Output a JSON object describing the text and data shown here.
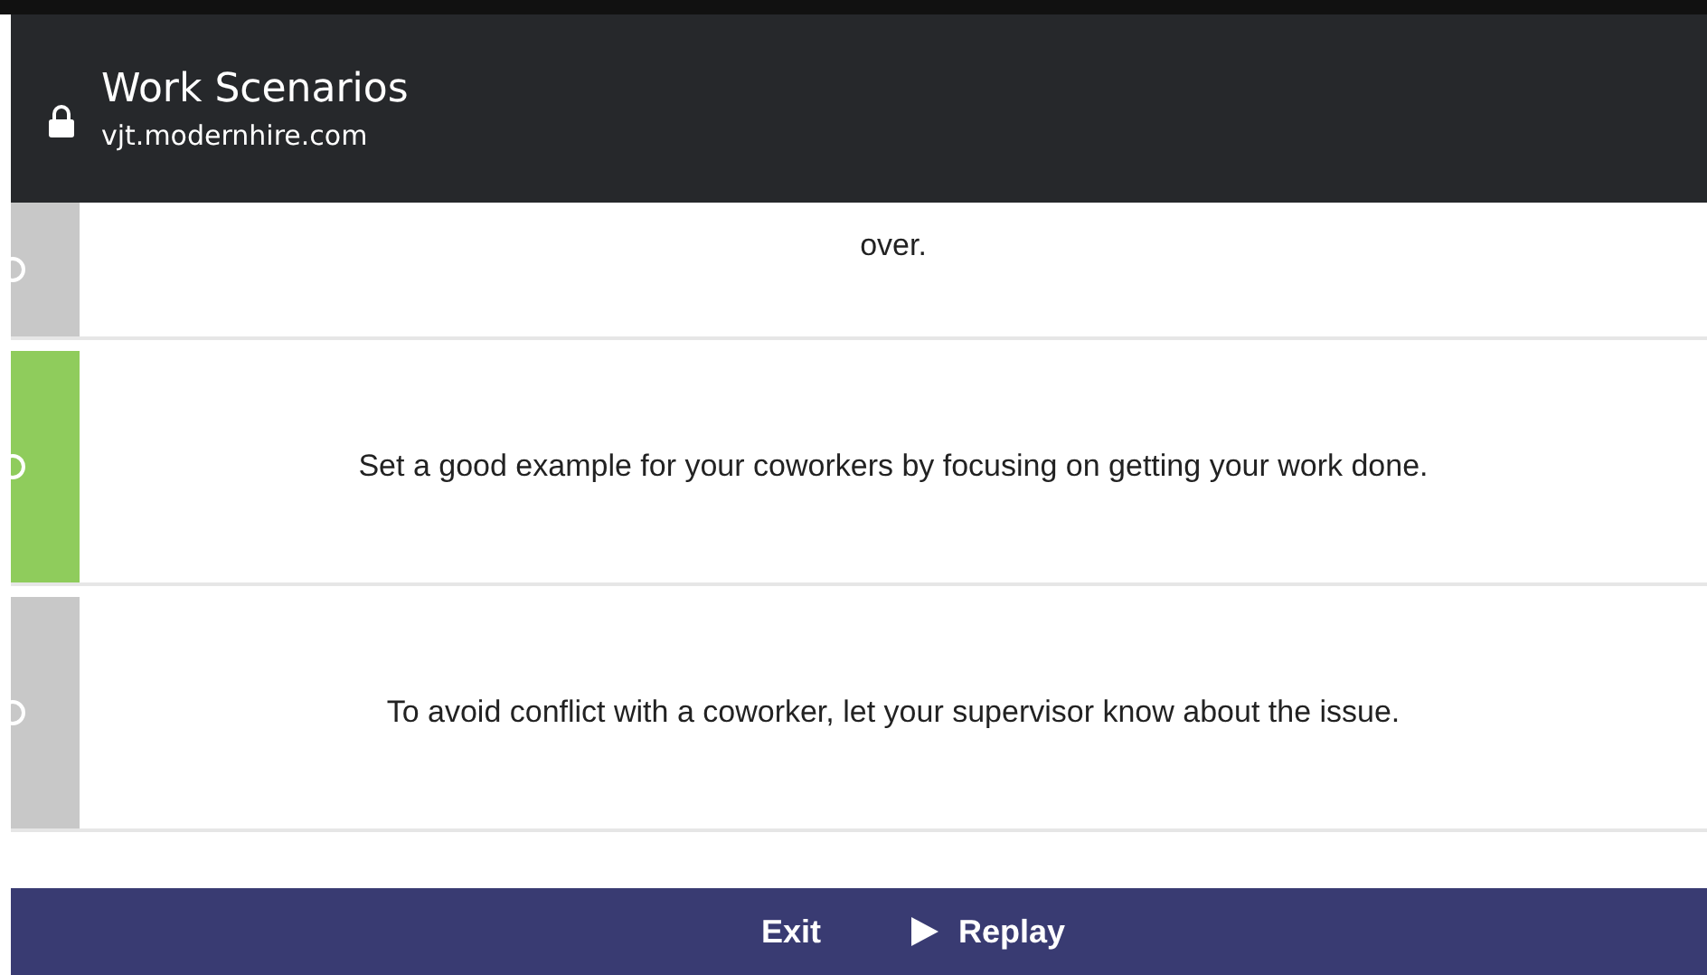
{
  "header": {
    "title": "Work Scenarios",
    "url": "vjt.modernhire.com"
  },
  "options": [
    {
      "text": "over.",
      "selected": false
    },
    {
      "text": "Set a good example for your coworkers by focusing on getting your work done.",
      "selected": true
    },
    {
      "text": "To avoid conflict with a coworker, let your supervisor know about the issue.",
      "selected": false
    }
  ],
  "footer": {
    "buttons": [
      {
        "label": "Exit",
        "kind": "exit"
      },
      {
        "label": "Replay",
        "kind": "replay"
      }
    ]
  }
}
